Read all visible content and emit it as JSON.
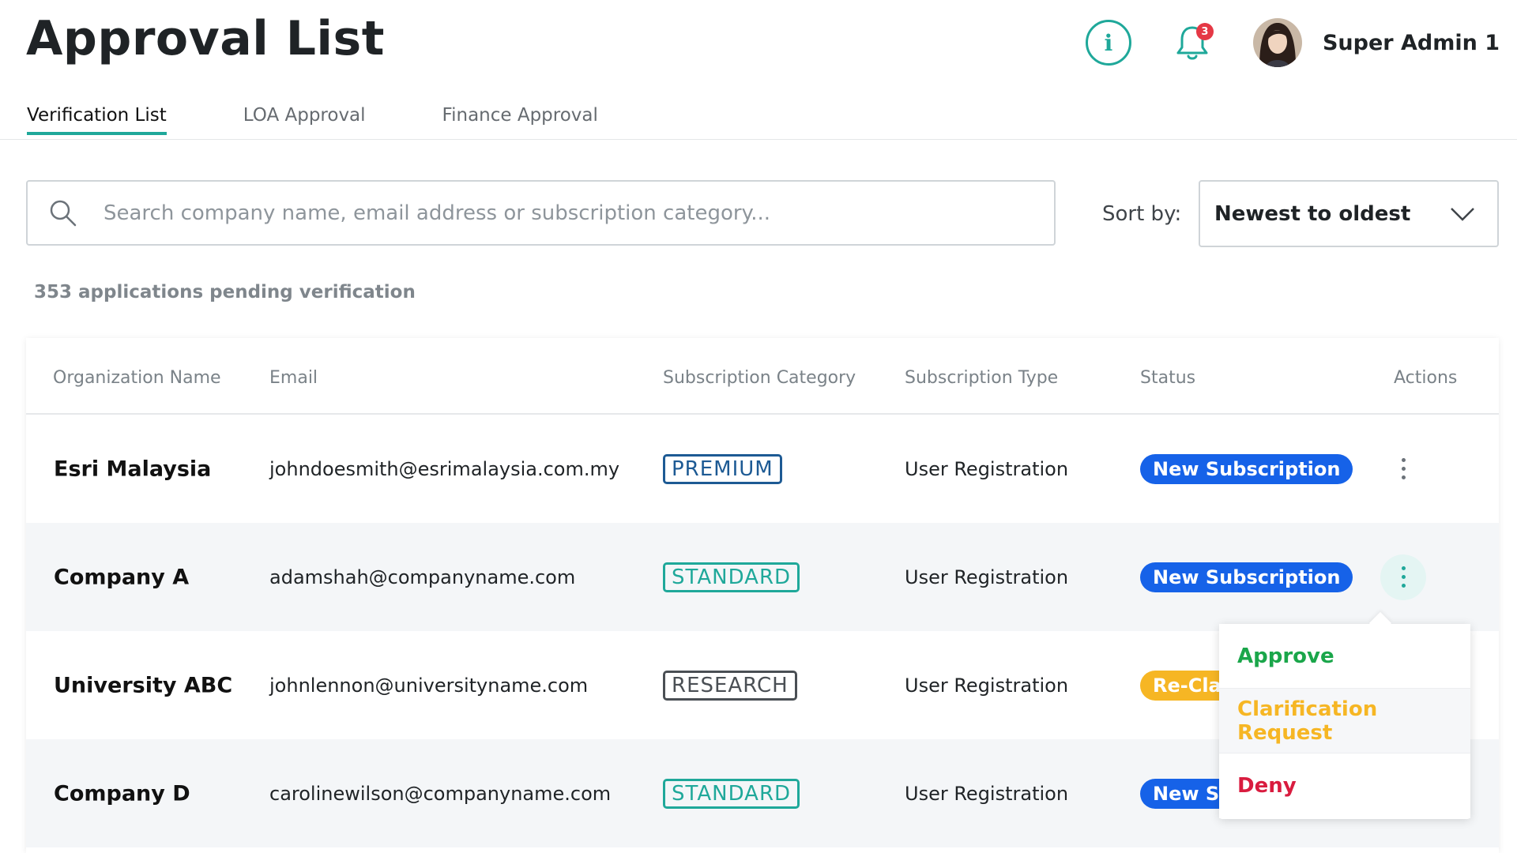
{
  "page": {
    "title": "Approval List"
  },
  "header": {
    "info_label": "i",
    "notifications": {
      "count": "3",
      "icon": "bell-icon"
    },
    "user": {
      "name": "Super Admin 1",
      "avatar": "avatar-photo"
    }
  },
  "tabs": [
    {
      "label": "Verification List",
      "active": true
    },
    {
      "label": "LOA Approval",
      "active": false
    },
    {
      "label": "Finance Approval",
      "active": false
    }
  ],
  "search": {
    "placeholder": "Search company name, email address or subscription category...",
    "value": "",
    "icon": "search-icon"
  },
  "sort": {
    "label": "Sort by:",
    "value": "Newest to oldest",
    "icon": "chevron-down-icon"
  },
  "pending_text": "353 applications pending verification",
  "table": {
    "columns": [
      "Organization Name",
      "Email",
      "Subscription Category",
      "Subscription Type",
      "Status",
      "Actions"
    ],
    "rows": [
      {
        "org": "Esri Malaysia",
        "email": "johndoesmith@esrimalaysia.com.my",
        "category": "PREMIUM",
        "category_color": "#1d5a94",
        "type": "User Registration",
        "status": "New Subscription",
        "status_color": "#1662e8"
      },
      {
        "org": "Company A",
        "email": "adamshah@companyname.com",
        "category": "STANDARD",
        "category_color": "#1fa89a",
        "type": "User Registration",
        "status": "New Subscription",
        "status_color": "#1662e8"
      },
      {
        "org": "University ABC",
        "email": "johnlennon@universityname.com",
        "category": "RESEARCH",
        "category_color": "#4a4f54",
        "type": "User Registration",
        "status": "Re-Cla",
        "status_color": "#f6b624"
      },
      {
        "org": "Company D",
        "email": "carolinewilson@companyname.com",
        "category": "STANDARD",
        "category_color": "#1fa89a",
        "type": "User Registration",
        "status": "New Su",
        "status_color": "#1662e8"
      }
    ]
  },
  "actions_menu": {
    "items": [
      {
        "label": "Approve",
        "color": "#1aa64a"
      },
      {
        "label": "Clarification Request",
        "color": "#f6b624"
      },
      {
        "label": "Deny",
        "color": "#d91c3f"
      }
    ]
  },
  "colors": {
    "accent": "#1fa89a",
    "kebab": "#6b7279"
  }
}
